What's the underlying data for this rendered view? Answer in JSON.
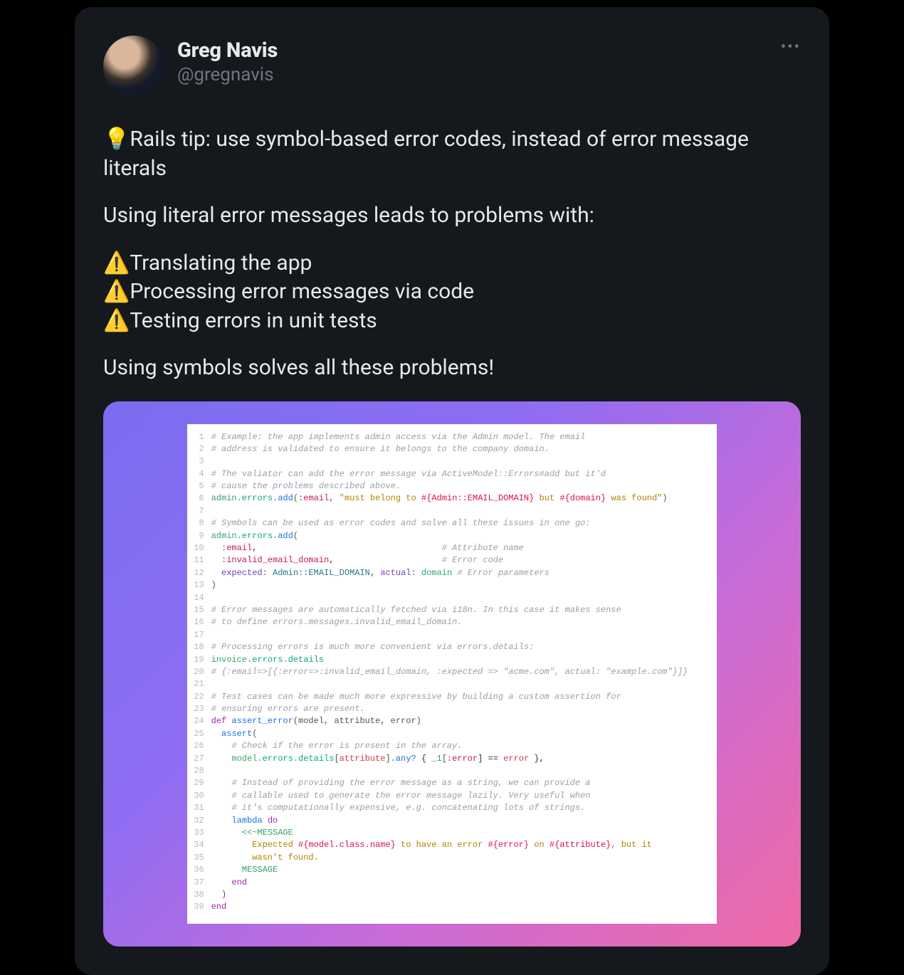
{
  "author": {
    "display_name": "Greg Navis",
    "handle": "@gregnavis"
  },
  "more_glyph": "•••",
  "post": {
    "line_tip": "💡Rails tip: use symbol-based error codes, instead of error message literals",
    "line_leadsto": "Using literal error messages leads to problems with:",
    "bullet_1": "⚠️Translating the app",
    "bullet_2": "⚠️Processing error messages via code",
    "bullet_3": "⚠️Testing errors in unit tests",
    "line_solve": "Using symbols solves all these problems!"
  },
  "code": {
    "c1": "# Example: the app implements admin access via the Admin model. The email",
    "c2": "# address is validated to ensure it belongs to the company domain.",
    "c4": "# The valiator can add the error message via ActiveModel::Errors#add but it'd",
    "c5": "# cause the problems described above.",
    "l6_a": "admin",
    "l6_b": ".errors",
    "l6_c": ".add",
    "l6_d": "(",
    "l6_e": ":email",
    "l6_f": ", ",
    "l6_g": "\"must belong to ",
    "l6_h": "#{Admin::EMAIL_DOMAIN}",
    "l6_i": " but ",
    "l6_j": "#{domain}",
    "l6_k": " was found\"",
    "l6_l": ")",
    "c8": "# Symbols can be used as error codes and solve all these issues in one go:",
    "l9_a": "admin",
    "l9_b": ".errors",
    "l9_c": ".add",
    "l9_d": "(",
    "l10_a": "  :email",
    "l10_b": ",                                    ",
    "l10_c": "# Attribute name",
    "l11_a": "  :invalid_email_domain",
    "l11_b": ",                     ",
    "l11_c": "# Error code",
    "l12_a": "  expected",
    "l12_b": ": ",
    "l12_c": "Admin::EMAIL_DOMAIN",
    "l12_d": ", ",
    "l12_e": "actual",
    "l12_f": ": ",
    "l12_g": "domain",
    "l12_h": " ",
    "l12_i": "# Error parameters",
    "l13": ")",
    "c15": "# Error messages are automatically fetched via i18n. In this case it makes sense",
    "c16": "# to define errors.messages.invalid_email_domain.",
    "c18": "# Processing errors is much more convenient via errors.details:",
    "l19_a": "invoice",
    "l19_b": ".errors",
    "l19_c": ".details",
    "c20": "# {:email=>[{:error=>:invalid_email_domain, :expected => \"acme.com\", actual: \"example.com\"}]}",
    "c22": "# Test cases can be made much more expressive by building a custom assertion for",
    "c23": "# ensuring errors are present.",
    "l24_a": "def",
    "l24_b": " ",
    "l24_c": "assert_error",
    "l24_d": "(model, attribute, error)",
    "l25_a": "  ",
    "l25_b": "assert",
    "l25_c": "(",
    "c26": "    # Check if the error is present in the array.",
    "l27_a": "    model",
    "l27_b": ".errors",
    "l27_c": ".details",
    "l27_d": "[",
    "l27_e": "attribute",
    "l27_f": "]",
    "l27_g": ".any?",
    "l27_h": " { ",
    "l27_i": "_1",
    "l27_j": "[",
    "l27_k": ":error",
    "l27_l": "] == ",
    "l27_m": "error",
    "l27_n": " },",
    "c29": "    # Instead of providing the error message as a string, we can provide a",
    "c30": "    # callable used to generate the error message lazily. Very useful when",
    "c31": "    # it's computationally expensive, e.g. concatenating lots of strings.",
    "l32_a": "    ",
    "l32_b": "lambda",
    "l32_c": " ",
    "l32_d": "do",
    "l33_a": "      ",
    "l33_b": "<<~MESSAGE",
    "l34_a": "        Expected ",
    "l34_b": "#{model.class.name}",
    "l34_c": " to have an error ",
    "l34_d": "#{error}",
    "l34_e": " on ",
    "l34_f": "#{attribute}",
    "l34_g": ", but it",
    "l35": "        wasn't found.",
    "l36": "      MESSAGE",
    "l37_a": "    ",
    "l37_b": "end",
    "l38": "  )",
    "l39": "end"
  },
  "linenos": {
    "n1": "1",
    "n2": "2",
    "n3": "3",
    "n4": "4",
    "n5": "5",
    "n6": "6",
    "n7": "7",
    "n8": "8",
    "n9": "9",
    "n10": "10",
    "n11": "11",
    "n12": "12",
    "n13": "13",
    "n14": "14",
    "n15": "15",
    "n16": "16",
    "n17": "17",
    "n18": "18",
    "n19": "19",
    "n20": "20",
    "n21": "21",
    "n22": "22",
    "n23": "23",
    "n24": "24",
    "n25": "25",
    "n26": "26",
    "n27": "27",
    "n28": "28",
    "n29": "29",
    "n30": "30",
    "n31": "31",
    "n32": "32",
    "n33": "33",
    "n34": "34",
    "n35": "35",
    "n36": "36",
    "n37": "37",
    "n38": "38",
    "n39": "39"
  }
}
